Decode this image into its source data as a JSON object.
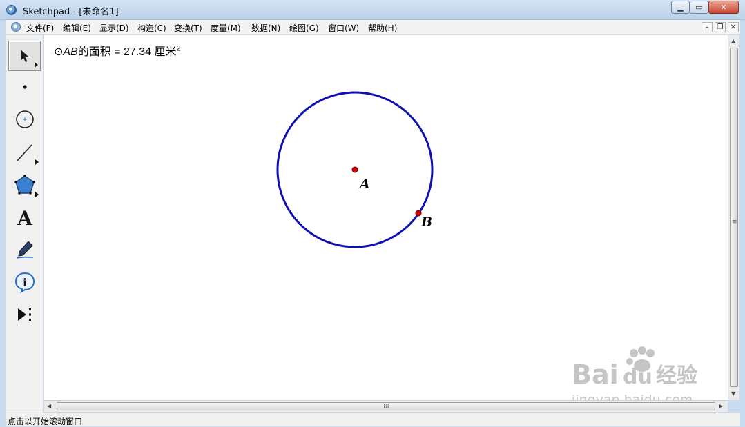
{
  "window": {
    "title": "Sketchpad  - [未命名1]",
    "min_label": "▁",
    "max_label": "▭",
    "close_label": "✕"
  },
  "menu": {
    "items": [
      "文件(F)",
      "编辑(E)",
      "显示(D)",
      "构造(C)",
      "变换(T)",
      "度量(M)",
      "数据(N)",
      "绘图(G)",
      "窗口(W)",
      "帮助(H)"
    ],
    "doc_min": "–",
    "doc_restore": "❐",
    "doc_close": "✕"
  },
  "toolbar": {
    "tools": [
      "selection-arrow",
      "point",
      "compass",
      "straightedge",
      "polygon",
      "text",
      "marker",
      "information",
      "custom"
    ]
  },
  "canvas": {
    "measurement": {
      "symbol": "⊙",
      "circle_name": "AB",
      "label": "的面积 = 27.34 厘米",
      "exponent": "2"
    },
    "circle_color": "#0f10b0",
    "point_color": "#d40000",
    "point_a_label": "A",
    "point_b_label": "B"
  },
  "status": {
    "text": "点击以开始滚动窗口"
  },
  "watermark": {
    "brand": "Bai",
    "brand2": "du",
    "product": "经验",
    "url": "jingyan.baidu.com"
  }
}
